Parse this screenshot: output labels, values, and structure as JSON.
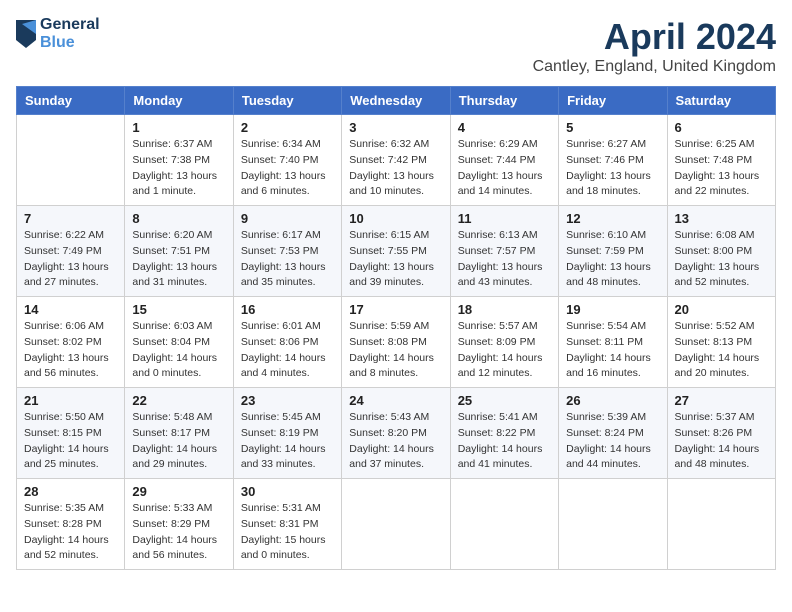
{
  "header": {
    "logo_line1": "General",
    "logo_line2": "Blue",
    "title": "April 2024",
    "subtitle": "Cantley, England, United Kingdom"
  },
  "weekdays": [
    "Sunday",
    "Monday",
    "Tuesday",
    "Wednesday",
    "Thursday",
    "Friday",
    "Saturday"
  ],
  "weeks": [
    [
      {
        "day": "",
        "info": ""
      },
      {
        "day": "1",
        "info": "Sunrise: 6:37 AM\nSunset: 7:38 PM\nDaylight: 13 hours\nand 1 minute."
      },
      {
        "day": "2",
        "info": "Sunrise: 6:34 AM\nSunset: 7:40 PM\nDaylight: 13 hours\nand 6 minutes."
      },
      {
        "day": "3",
        "info": "Sunrise: 6:32 AM\nSunset: 7:42 PM\nDaylight: 13 hours\nand 10 minutes."
      },
      {
        "day": "4",
        "info": "Sunrise: 6:29 AM\nSunset: 7:44 PM\nDaylight: 13 hours\nand 14 minutes."
      },
      {
        "day": "5",
        "info": "Sunrise: 6:27 AM\nSunset: 7:46 PM\nDaylight: 13 hours\nand 18 minutes."
      },
      {
        "day": "6",
        "info": "Sunrise: 6:25 AM\nSunset: 7:48 PM\nDaylight: 13 hours\nand 22 minutes."
      }
    ],
    [
      {
        "day": "7",
        "info": "Sunrise: 6:22 AM\nSunset: 7:49 PM\nDaylight: 13 hours\nand 27 minutes."
      },
      {
        "day": "8",
        "info": "Sunrise: 6:20 AM\nSunset: 7:51 PM\nDaylight: 13 hours\nand 31 minutes."
      },
      {
        "day": "9",
        "info": "Sunrise: 6:17 AM\nSunset: 7:53 PM\nDaylight: 13 hours\nand 35 minutes."
      },
      {
        "day": "10",
        "info": "Sunrise: 6:15 AM\nSunset: 7:55 PM\nDaylight: 13 hours\nand 39 minutes."
      },
      {
        "day": "11",
        "info": "Sunrise: 6:13 AM\nSunset: 7:57 PM\nDaylight: 13 hours\nand 43 minutes."
      },
      {
        "day": "12",
        "info": "Sunrise: 6:10 AM\nSunset: 7:59 PM\nDaylight: 13 hours\nand 48 minutes."
      },
      {
        "day": "13",
        "info": "Sunrise: 6:08 AM\nSunset: 8:00 PM\nDaylight: 13 hours\nand 52 minutes."
      }
    ],
    [
      {
        "day": "14",
        "info": "Sunrise: 6:06 AM\nSunset: 8:02 PM\nDaylight: 13 hours\nand 56 minutes."
      },
      {
        "day": "15",
        "info": "Sunrise: 6:03 AM\nSunset: 8:04 PM\nDaylight: 14 hours\nand 0 minutes."
      },
      {
        "day": "16",
        "info": "Sunrise: 6:01 AM\nSunset: 8:06 PM\nDaylight: 14 hours\nand 4 minutes."
      },
      {
        "day": "17",
        "info": "Sunrise: 5:59 AM\nSunset: 8:08 PM\nDaylight: 14 hours\nand 8 minutes."
      },
      {
        "day": "18",
        "info": "Sunrise: 5:57 AM\nSunset: 8:09 PM\nDaylight: 14 hours\nand 12 minutes."
      },
      {
        "day": "19",
        "info": "Sunrise: 5:54 AM\nSunset: 8:11 PM\nDaylight: 14 hours\nand 16 minutes."
      },
      {
        "day": "20",
        "info": "Sunrise: 5:52 AM\nSunset: 8:13 PM\nDaylight: 14 hours\nand 20 minutes."
      }
    ],
    [
      {
        "day": "21",
        "info": "Sunrise: 5:50 AM\nSunset: 8:15 PM\nDaylight: 14 hours\nand 25 minutes."
      },
      {
        "day": "22",
        "info": "Sunrise: 5:48 AM\nSunset: 8:17 PM\nDaylight: 14 hours\nand 29 minutes."
      },
      {
        "day": "23",
        "info": "Sunrise: 5:45 AM\nSunset: 8:19 PM\nDaylight: 14 hours\nand 33 minutes."
      },
      {
        "day": "24",
        "info": "Sunrise: 5:43 AM\nSunset: 8:20 PM\nDaylight: 14 hours\nand 37 minutes."
      },
      {
        "day": "25",
        "info": "Sunrise: 5:41 AM\nSunset: 8:22 PM\nDaylight: 14 hours\nand 41 minutes."
      },
      {
        "day": "26",
        "info": "Sunrise: 5:39 AM\nSunset: 8:24 PM\nDaylight: 14 hours\nand 44 minutes."
      },
      {
        "day": "27",
        "info": "Sunrise: 5:37 AM\nSunset: 8:26 PM\nDaylight: 14 hours\nand 48 minutes."
      }
    ],
    [
      {
        "day": "28",
        "info": "Sunrise: 5:35 AM\nSunset: 8:28 PM\nDaylight: 14 hours\nand 52 minutes."
      },
      {
        "day": "29",
        "info": "Sunrise: 5:33 AM\nSunset: 8:29 PM\nDaylight: 14 hours\nand 56 minutes."
      },
      {
        "day": "30",
        "info": "Sunrise: 5:31 AM\nSunset: 8:31 PM\nDaylight: 15 hours\nand 0 minutes."
      },
      {
        "day": "",
        "info": ""
      },
      {
        "day": "",
        "info": ""
      },
      {
        "day": "",
        "info": ""
      },
      {
        "day": "",
        "info": ""
      }
    ]
  ]
}
